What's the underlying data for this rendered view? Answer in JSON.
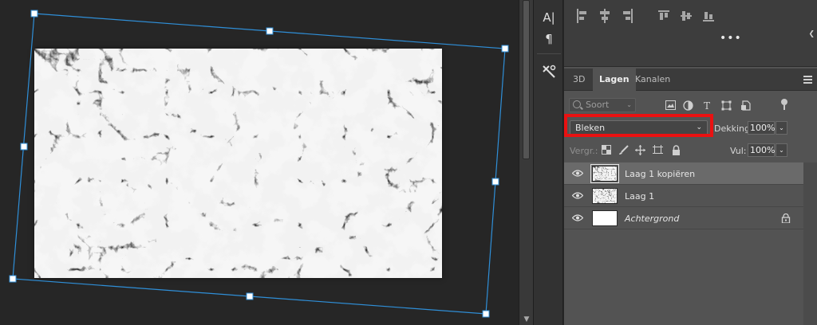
{
  "toolstrip": {
    "items": [
      {
        "icon": "character-icon",
        "glyph": "A|"
      },
      {
        "icon": "paragraph-icon",
        "glyph": "¶"
      },
      {
        "icon": "tools-icon",
        "glyph": "✂"
      }
    ]
  },
  "align_bar": {
    "more": "•••",
    "collapse": "❮"
  },
  "tabs": [
    {
      "label": "3D",
      "active": false
    },
    {
      "label": "Lagen",
      "active": true
    },
    {
      "label": "Kanalen",
      "active": false
    }
  ],
  "filter": {
    "kind_placeholder": "Soort",
    "chevron": "⌄"
  },
  "blend": {
    "mode": "Bleken",
    "chevron": "⌄",
    "opacity_label": "Dekking:",
    "opacity_value": "100%",
    "highlight_color": "#ea1111"
  },
  "lock": {
    "label": "Vergr.:",
    "fill_label": "Vul:",
    "fill_value": "100%"
  },
  "layers": [
    {
      "name": "Laag 1 kopiëren",
      "type": "marble",
      "selected": true,
      "visible": true,
      "italic": false,
      "locked": false
    },
    {
      "name": "Laag 1",
      "type": "marble",
      "selected": false,
      "visible": true,
      "italic": false,
      "locked": false
    },
    {
      "name": "Achtergrond",
      "type": "white",
      "selected": false,
      "visible": true,
      "italic": true,
      "locked": true
    }
  ],
  "colors": {
    "transform_handle": "#2f8fd8",
    "panel_bg": "#535353",
    "canvas_bg": "#262626"
  }
}
